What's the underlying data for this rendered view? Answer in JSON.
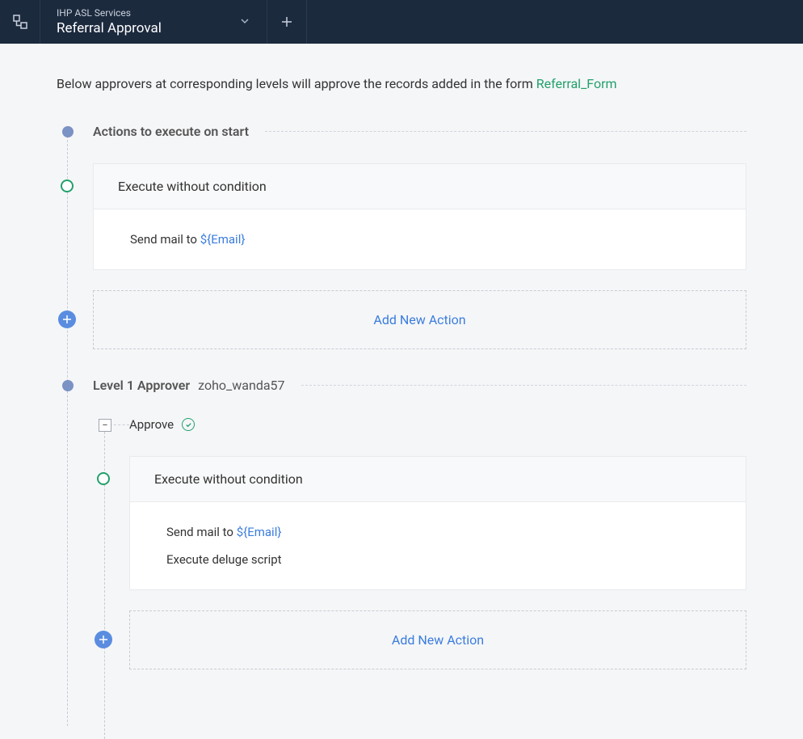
{
  "header": {
    "subtitle": "IHP ASL Services",
    "title": "Referral Approval"
  },
  "intro": {
    "text": "Below approvers at corresponding levels will approve the records added in the form ",
    "link_text": "Referral_Form"
  },
  "sections": [
    {
      "title": "Actions to execute on start",
      "blocks": [
        {
          "condition_label": "Execute without condition",
          "actions": [
            {
              "prefix": "Send mail to ",
              "var": "${Email}"
            }
          ]
        }
      ],
      "add_action_label": "Add New Action"
    },
    {
      "title_prefix": "Level 1 Approver",
      "title_secondary": "zoho_wanda57",
      "subsections": [
        {
          "label": "Approve",
          "blocks": [
            {
              "condition_label": "Execute without condition",
              "actions": [
                {
                  "prefix": "Send mail to ",
                  "var": "${Email}"
                },
                {
                  "prefix": "Execute deluge script",
                  "var": ""
                }
              ]
            }
          ],
          "add_action_label": "Add New Action"
        }
      ]
    }
  ]
}
